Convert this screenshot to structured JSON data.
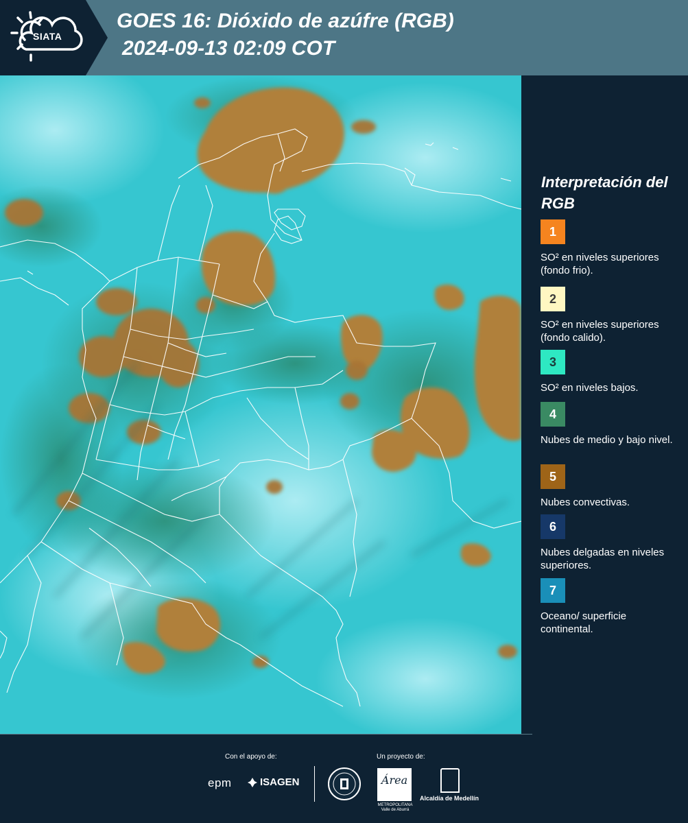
{
  "header": {
    "logo_text": "SIATA",
    "title_line1": "GOES 16: Dióxido de azúfre (RGB)",
    "title_line2": "2024-09-13 02:09 COT",
    "background_color": "#4d7686"
  },
  "legend": {
    "title": "Interpretación del RGB",
    "items": [
      {
        "number": "1",
        "label": "SO² en niveles superiores (fondo frio).",
        "color": "#f5841f",
        "text_color": "#ffffff"
      },
      {
        "number": "2",
        "label": "SO² en niveles superiores (fondo calido).",
        "color": "#fff7c2",
        "text_color": "#3a3a3a"
      },
      {
        "number": "3",
        "label": "SO² en niveles bajos.",
        "color": "#2ee8c2",
        "text_color": "#1d3a3a"
      },
      {
        "number": "4",
        "label": "Nubes de medio y bajo nivel.",
        "color": "#3a8a63",
        "text_color": "#ffffff"
      },
      {
        "number": "5",
        "label": "Nubes convectivas.",
        "color": "#9e6418",
        "text_color": "#ffffff"
      },
      {
        "number": "6",
        "label": "Nubes delgadas en niveles superiores.",
        "color": "#163868",
        "text_color": "#ffffff"
      },
      {
        "number": "7",
        "label": "Oceano/ superficie continental.",
        "color": "#1a8fb8",
        "text_color": "#ffffff"
      }
    ]
  },
  "footer": {
    "support_label": "Con el apoyo de:",
    "project_label": "Un proyecto de:",
    "epm": "epm",
    "isagen": "ISAGEN",
    "area_logo": "Área",
    "area_sub": "METROPOLITANA Valle de Aburrá",
    "alcaldia": "Alcaldía de Medellín"
  },
  "map": {
    "background_color": "#36c6d0",
    "cloud_color": "#b0803a",
    "border_color": "#ffffff"
  }
}
